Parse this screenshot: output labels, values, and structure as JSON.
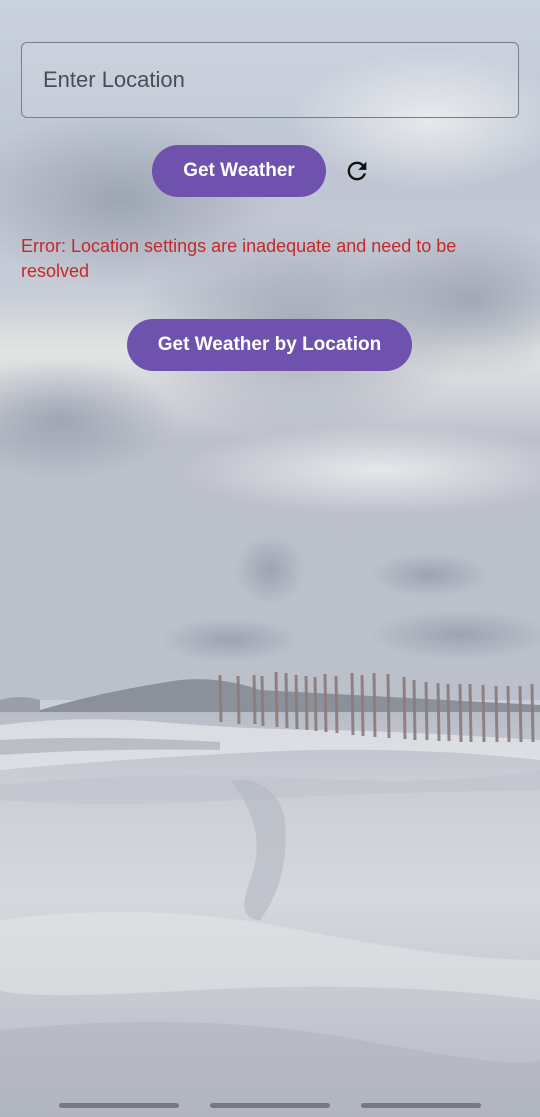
{
  "search": {
    "placeholder": "Enter Location",
    "value": ""
  },
  "buttons": {
    "get_weather": "Get Weather",
    "get_weather_by_location": "Get Weather by Location"
  },
  "icons": {
    "refresh": "refresh-icon"
  },
  "error": {
    "message": "Error: Location settings are inadequate and need to be resolved"
  },
  "colors": {
    "accent": "#6e52ad",
    "error": "#c62828"
  }
}
